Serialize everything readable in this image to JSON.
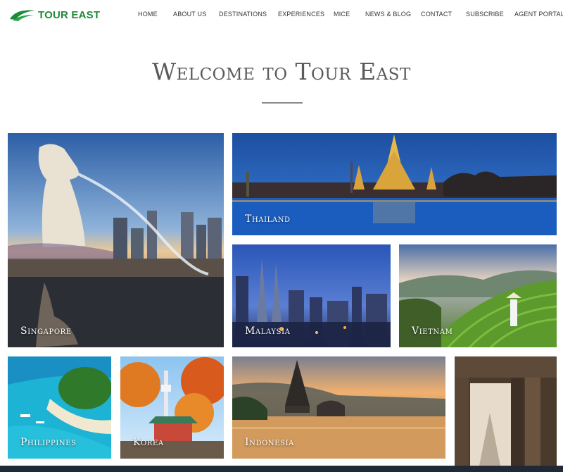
{
  "brand": {
    "name": "TOUR EAST",
    "color": "#1f8a3a"
  },
  "nav": [
    "HOME",
    "ABOUT US",
    "DESTINATIONS",
    "EXPERIENCES",
    "MICE",
    "NEWS & BLOG",
    "CONTACT",
    "SUBSCRIBE",
    "AGENT PORTAL"
  ],
  "hero": {
    "title": "Welcome to Tour East"
  },
  "destinations": [
    "Singapore",
    "Thailand",
    "Malaysia",
    "Vietnam",
    "Philippines",
    "Korea",
    "Indonesia"
  ]
}
